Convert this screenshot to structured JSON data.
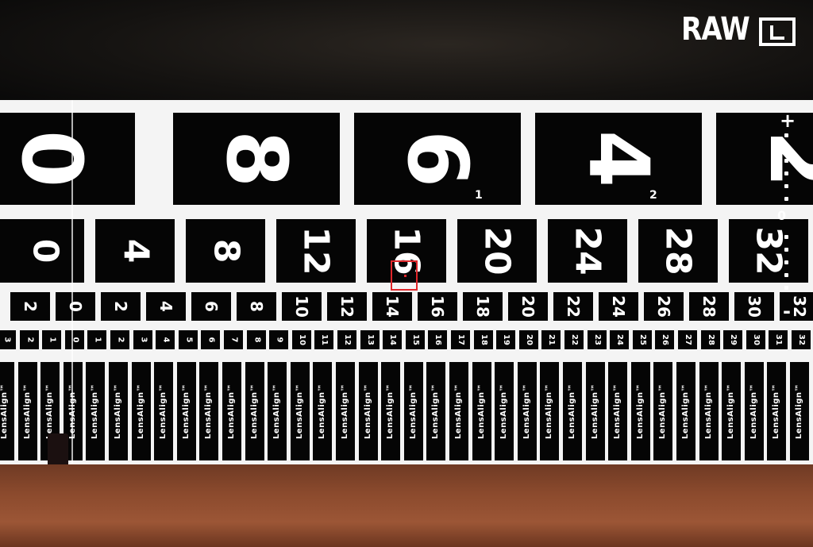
{
  "osd": {
    "format": "RAW",
    "quality_icon": "large-quality-icon",
    "exposure_plus": "+",
    "exposure_minus": "-",
    "exposure_zero": "0"
  },
  "ruler": {
    "brand": "LensAlign™",
    "row1": [
      "0",
      "8",
      "6",
      "4",
      "2"
    ],
    "row1_sub": [
      "1",
      "2"
    ],
    "row2": [
      "0",
      "4",
      "8",
      "12",
      "16",
      "20",
      "24",
      "28",
      "32"
    ],
    "row3": [
      "2",
      "0",
      "2",
      "4",
      "6",
      "8",
      "10",
      "12",
      "14",
      "16",
      "18",
      "20",
      "22",
      "24",
      "26",
      "28",
      "30",
      "32"
    ],
    "row4": [
      "3",
      "2",
      "1",
      "0",
      "1",
      "2",
      "3",
      "4",
      "5",
      "6",
      "7",
      "8",
      "9",
      "10",
      "11",
      "12",
      "13",
      "14",
      "15",
      "16",
      "17",
      "18",
      "19",
      "20",
      "21",
      "22",
      "23",
      "24",
      "25",
      "26",
      "27",
      "28",
      "29",
      "30",
      "31",
      "32"
    ]
  },
  "colors": {
    "af_point": "#e0262a",
    "osd_text": "#ffffff",
    "ruler_black": "#050505",
    "table": "#8b4a2d"
  }
}
